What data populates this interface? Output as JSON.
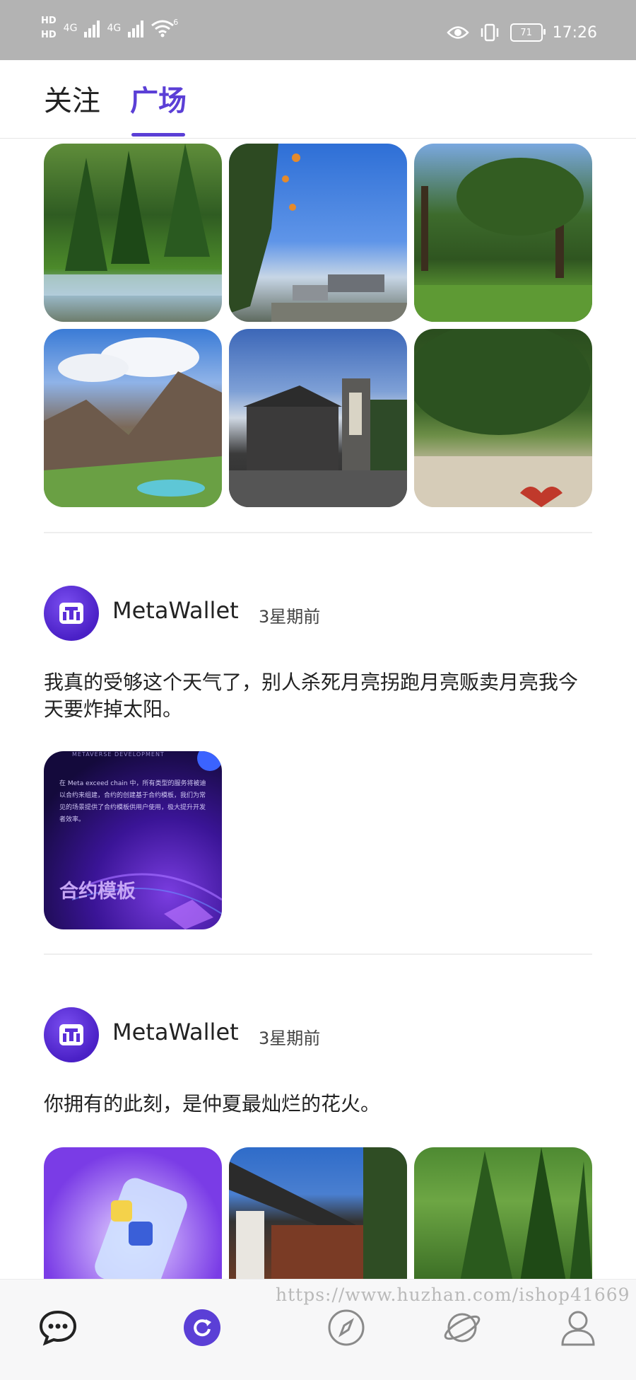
{
  "status_bar": {
    "hd_top": "HD",
    "hd_bottom": "HD",
    "network1": "4G",
    "network2": "4G",
    "wifi_label": "6",
    "battery": "71",
    "time": "17:26"
  },
  "tabs": [
    {
      "label": "关注",
      "active": false
    },
    {
      "label": "广场",
      "active": true
    }
  ],
  "gallery_top": {
    "images": [
      "forest-river-photo",
      "street-sky-photo",
      "park-trees-photo",
      "mountain-lake-photo",
      "building-gate-photo",
      "forest-sand-photo"
    ]
  },
  "posts": [
    {
      "author": "MetaWallet",
      "time": "3星期前",
      "text": "我真的受够这个天气了，别人杀死月亮拐跑月亮贩卖月亮我今天要炸掉太阳。",
      "image": {
        "title": "合约模板",
        "body": "在 Meta exceed chain 中，所有类型的服务将被迪以合约来组建，合约的创建基于合约模板，我们为常见的场景提供了合约模板供用户使用，极大提升开发者效率。",
        "header": "METAVERSE DEVELOPMENT"
      }
    },
    {
      "author": "MetaWallet",
      "time": "3星期前",
      "text": "你拥有的此刻，是仲夏最灿烂的花火。",
      "images": [
        "phone-app-illustration",
        "temple-roof-photo",
        "pine-trees-photo"
      ]
    }
  ],
  "watermark": "https://www.huzhan.com/ishop41669",
  "bottom_nav": [
    "chat-icon",
    "refresh-icon",
    "compass-icon",
    "planet-icon",
    "profile-icon"
  ],
  "colors": {
    "accent": "#5b3fd6",
    "status_bar": "#b3b3b3"
  }
}
